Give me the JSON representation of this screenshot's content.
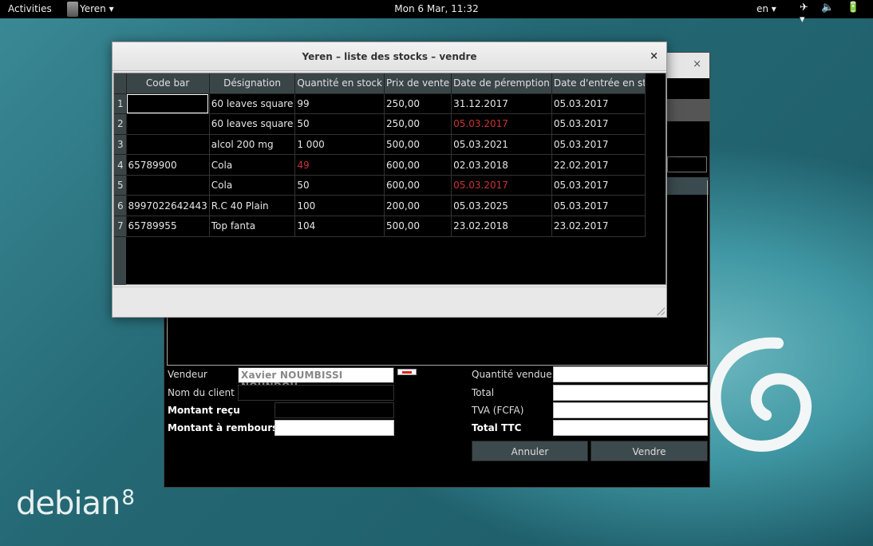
{
  "topbar": {
    "activities": "Activities",
    "app_name": "Yeren ▾",
    "clock": "Mon  6 Mar, 11:32",
    "lang": "en ▾",
    "system_icons": "✈ 🔈 🔋 ▾"
  },
  "desktop": {
    "logo_text": "debian",
    "logo_version": "8"
  },
  "dialog": {
    "title": "Yeren – liste des stocks – vendre",
    "close": "×",
    "columns": [
      "Code bar",
      "Désignation",
      "Quantité en stock",
      "Prix de vente",
      "Date de péremption",
      "Date d'entrée en stock"
    ],
    "rows": [
      {
        "n": "1",
        "code": "",
        "designation": "60 leaves square",
        "qty": "99",
        "price": "250,00",
        "expiry": "31.12.2017",
        "entry": "05.03.2017",
        "qty_red": false,
        "exp_red": false
      },
      {
        "n": "2",
        "code": "",
        "designation": "60 leaves square",
        "qty": "50",
        "price": "250,00",
        "expiry": "05.03.2017",
        "entry": "05.03.2017",
        "qty_red": false,
        "exp_red": true
      },
      {
        "n": "3",
        "code": "",
        "designation": "alcol 200 mg",
        "qty": "1 000",
        "price": "500,00",
        "expiry": "05.03.2021",
        "entry": "05.03.2017",
        "qty_red": false,
        "exp_red": false
      },
      {
        "n": "4",
        "code": "65789900",
        "designation": "Cola",
        "qty": "49",
        "price": "600,00",
        "expiry": "02.03.2018",
        "entry": "22.02.2017",
        "qty_red": true,
        "exp_red": false
      },
      {
        "n": "5",
        "code": "",
        "designation": "Cola",
        "qty": "50",
        "price": "600,00",
        "expiry": "05.03.2017",
        "entry": "05.03.2017",
        "qty_red": false,
        "exp_red": true
      },
      {
        "n": "6",
        "code": "8997022642443",
        "designation": "R.C 40 Plain",
        "qty": "100",
        "price": "200,00",
        "expiry": "05.03.2025",
        "entry": "05.03.2017",
        "qty_red": false,
        "exp_red": false
      },
      {
        "n": "7",
        "code": "65789955",
        "designation": "Top fanta",
        "qty": "104",
        "price": "500,00",
        "expiry": "23.02.2018",
        "entry": "23.02.2017",
        "qty_red": false,
        "exp_red": false
      }
    ]
  },
  "sale_form": {
    "bg_close": "×",
    "vendeur_label": "Vendeur",
    "vendeur_value": "Xavier NOUMBISSI NOUNDOU",
    "client_label": "Nom du client",
    "montant_recu_label": "Montant reçu",
    "montant_rembourser_label": "Montant à rembourser",
    "quantite_label": "Quantité vendue",
    "total_label": "Total",
    "tva_label": "TVA (FCFA)",
    "total_ttc_label": "Total TTC",
    "annuler": "Annuler",
    "vendre": "Vendre"
  },
  "colors": {
    "alert_red": "#cc3333",
    "header_bg": "#3a4548"
  }
}
